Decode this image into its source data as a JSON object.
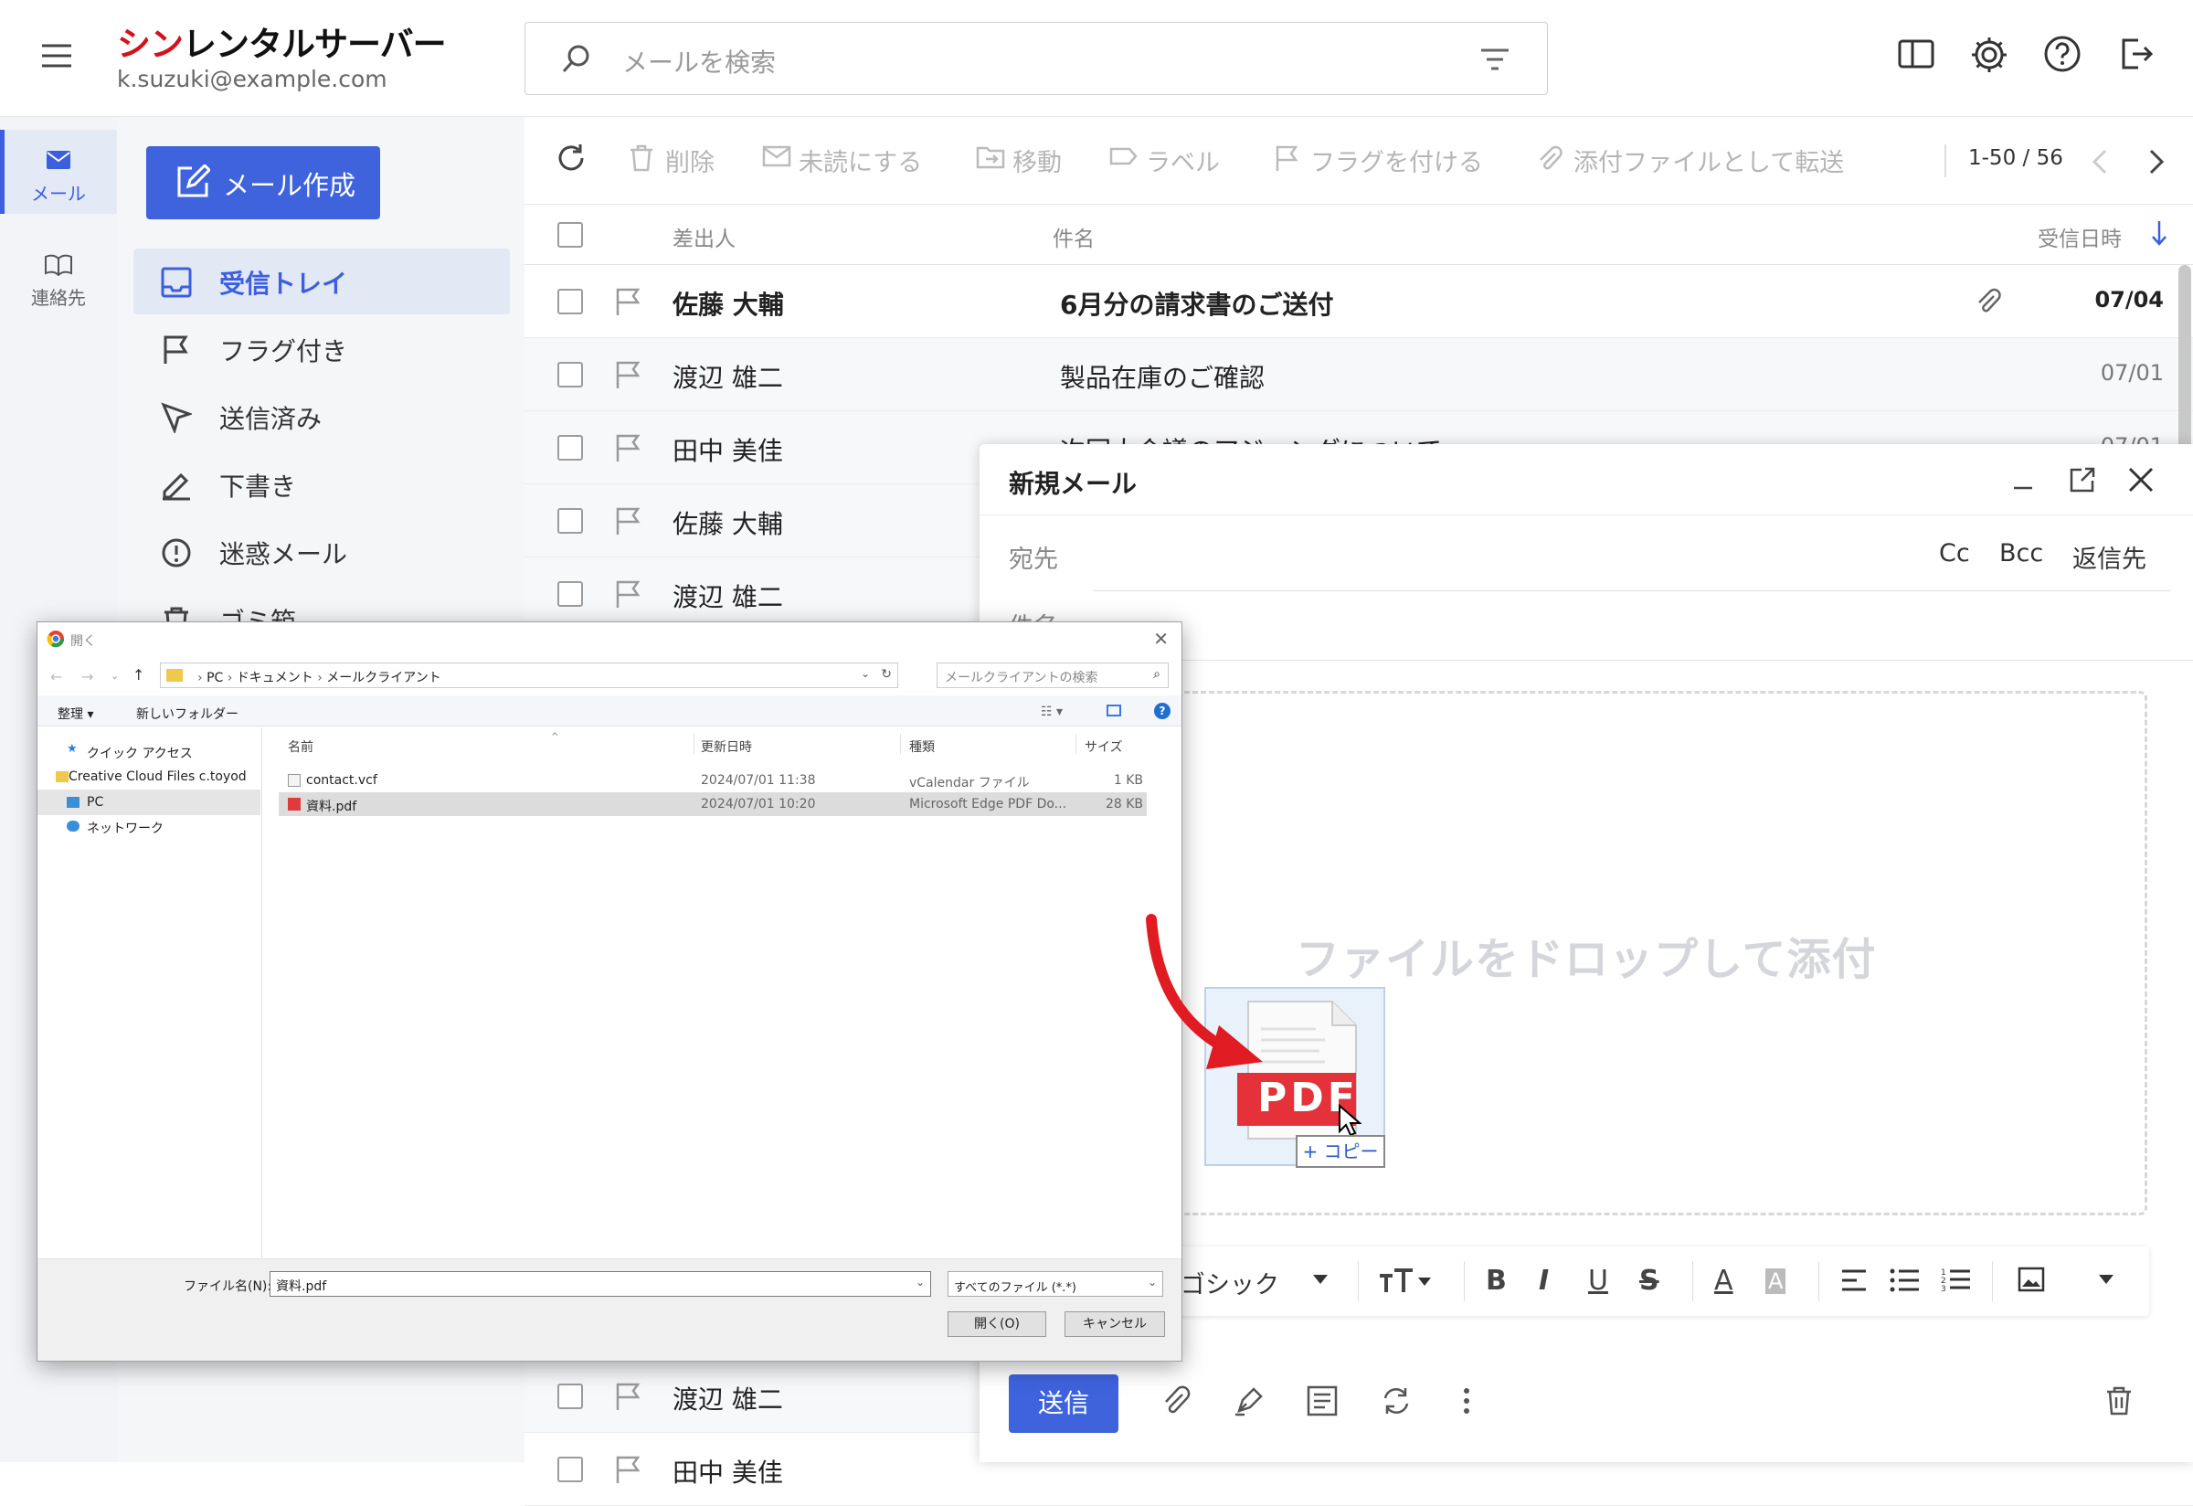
{
  "app": {
    "logo_red": "シン",
    "logo_rest": "レンタルサーバー",
    "account": "k.suzuki@example.com"
  },
  "search": {
    "placeholder": "メールを検索"
  },
  "rail": {
    "mail": "メール",
    "contacts": "連絡先"
  },
  "sidebar": {
    "compose": "メール作成",
    "folders": [
      {
        "label": "受信トレイ"
      },
      {
        "label": "フラグ付き"
      },
      {
        "label": "送信済み"
      },
      {
        "label": "下書き"
      },
      {
        "label": "迷惑メール"
      },
      {
        "label": "ゴミ箱"
      }
    ]
  },
  "toolbar": {
    "delete": "削除",
    "unread": "未読にする",
    "move": "移動",
    "label": "ラベル",
    "flag": "フラグを付ける",
    "forward_attach": "添付ファイルとして転送",
    "pager": "1-50 / 56"
  },
  "list": {
    "col_from": "差出人",
    "col_subject": "件名",
    "col_date": "受信日時",
    "rows": [
      {
        "from": "佐藤 大輔",
        "subject": "6月分の請求書のご送付",
        "date": "07/04"
      },
      {
        "from": "渡辺 雄二",
        "subject": "製品在庫のご確認",
        "date": "07/01"
      },
      {
        "from": "田中 美佳",
        "subject": "次回大会議のアジェンダについて",
        "date": "07/01"
      },
      {
        "from": "佐藤 大輔",
        "subject": "",
        "date": ""
      },
      {
        "from": "渡辺 雄二",
        "subject": "",
        "date": ""
      },
      {
        "from": "渡辺 雄二",
        "subject": "",
        "date": ""
      },
      {
        "from": "田中 美佳",
        "subject": "",
        "date": ""
      }
    ]
  },
  "compose": {
    "title": "新規メール",
    "to": "宛先",
    "cc": "Cc",
    "bcc": "Bcc",
    "reply_to": "返信先",
    "subject": "件名",
    "drop": "ファイルをドロップして添付",
    "font": "ゴシック",
    "send": "送信"
  },
  "dialog": {
    "title": "開く",
    "path": [
      "PC",
      "ドキュメント",
      "メールクライアント"
    ],
    "search_placeholder": "メールクライアントの検索",
    "organize": "整理 ▾",
    "new_folder": "新しいフォルダー",
    "nav": [
      "クイック アクセス",
      "Creative Cloud Files  c.toyod",
      "PC",
      "ネットワーク"
    ],
    "columns": {
      "name": "名前",
      "modified": "更新日時",
      "type": "種類",
      "size": "サイズ"
    },
    "files": [
      {
        "name": "contact.vcf",
        "modified": "2024/07/01 11:38",
        "type": "vCalendar ファイル",
        "size": "1 KB"
      },
      {
        "name": "資料.pdf",
        "modified": "2024/07/01 10:20",
        "type": "Microsoft Edge PDF Do...",
        "size": "28 KB"
      }
    ],
    "filename_label": "ファイル名(N):",
    "filename": "資料.pdf",
    "filetype": "すべてのファイル (*.*)",
    "open": "開く(O)",
    "cancel": "キャンセル"
  },
  "drag": {
    "badge": "PDF",
    "copy": "+ コピー"
  },
  "colors": {
    "accent": "#3e63dd",
    "logo_red": "#d3121b"
  }
}
